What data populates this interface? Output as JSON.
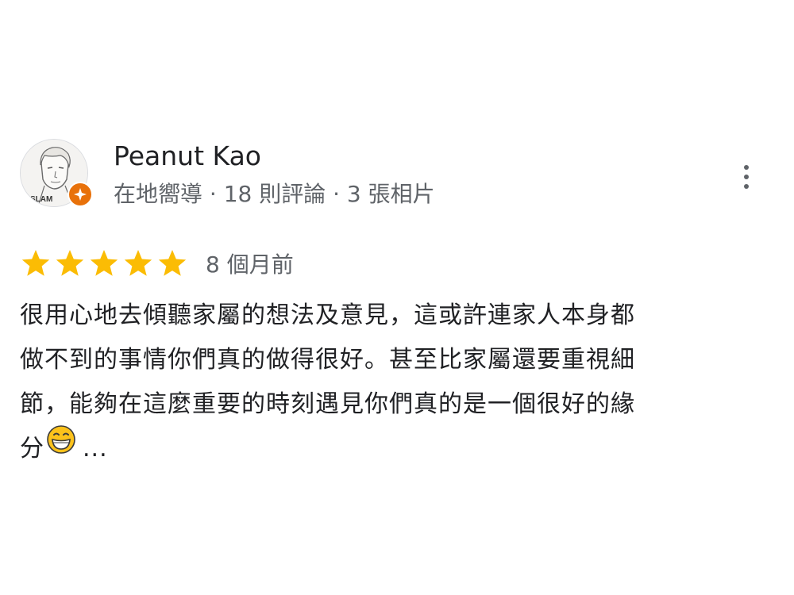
{
  "reviewer": {
    "name": "Peanut Kao",
    "meta": "在地嚮導 · 18 則評論 · 3 張相片",
    "avatar_icon": "user-avatar-icon",
    "badge_icon": "local-guide-badge-icon",
    "badge_color": "#e8710a"
  },
  "menu": {
    "icon": "more-vert-icon"
  },
  "review": {
    "rating": 5,
    "rating_max": 5,
    "star_color": "#fbbc04",
    "date": "8 個月前",
    "text_lines": [
      "很用心地去傾聽家屬的想法及意見，這或許連家人本身都",
      "做不到的事情你們真的做得很好。甚至比家屬還要重視細",
      "節，能夠在這麼重要的時刻遇見你們真的是一個很好的緣",
      "分"
    ],
    "emoji": "grinning-face-emoji",
    "more": "..."
  }
}
